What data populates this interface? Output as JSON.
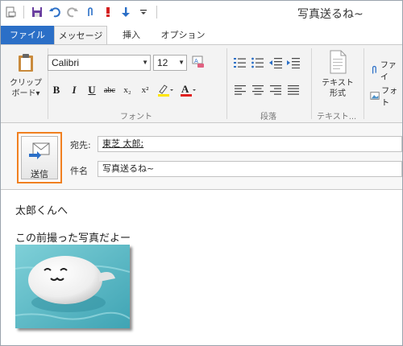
{
  "window": {
    "title": "写真送るね~"
  },
  "qat": {
    "icons": [
      "new-mail-icon",
      "save-icon",
      "undo-icon",
      "redo-icon",
      "attach-icon",
      "high-priority-icon",
      "low-priority-icon",
      "customize-qat-icon"
    ]
  },
  "tabs": [
    {
      "label": "ファイル"
    },
    {
      "label": "メッセージ"
    },
    {
      "label": "挿入"
    },
    {
      "label": "オプション"
    }
  ],
  "ribbon": {
    "clipboard": {
      "label": "クリップボード▾"
    },
    "font": {
      "group_label": "フォント",
      "family": "Calibri",
      "size": "12",
      "bold": "B",
      "italic": "I",
      "underline": "U",
      "strike": "abc",
      "subscript": "x₂",
      "superscript": "x²",
      "highlight_color": "#ffe600",
      "font_color": "#e02020"
    },
    "paragraph": {
      "group_label": "段落"
    },
    "text": {
      "button_label": "テキスト形式",
      "group_label": "テキスト..."
    },
    "include": {
      "attach_label": "ファイ",
      "photo_label": "フォト"
    }
  },
  "header": {
    "send_label": "送信",
    "to_label": "宛先:",
    "to_value": "東芝 太郎;",
    "subject_label": "件名",
    "subject_value": "写真送るね~"
  },
  "message": {
    "line1": "太郎くんへ",
    "line2": "この前撮った写真だよー"
  },
  "colors": {
    "accent": "#2b6fc7",
    "send_highlight": "#f08020"
  }
}
